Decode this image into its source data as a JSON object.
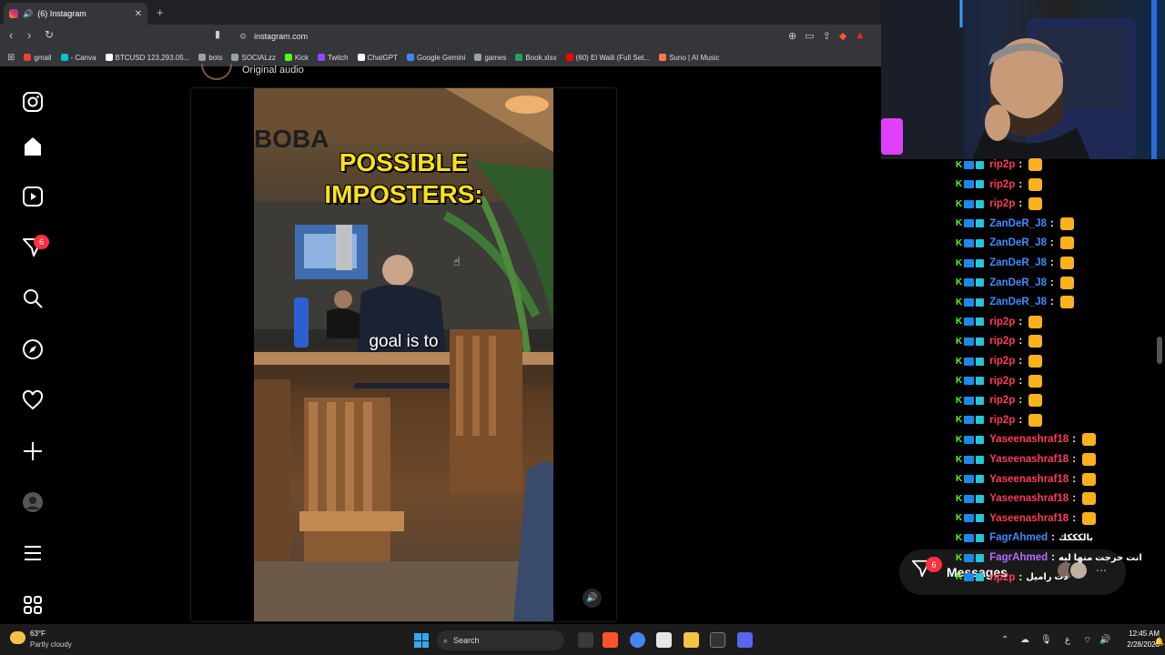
{
  "browser": {
    "tab_title": "(6) Instagram",
    "url": "instagram.com",
    "new_tab": "+",
    "bookmarks": [
      {
        "label": "gmail",
        "color": "#ea4335"
      },
      {
        "label": "- Canva",
        "color": "#00c4cc"
      },
      {
        "label": "BTCUSD 123,293.05...",
        "color": "#ffffff"
      },
      {
        "label": "bots",
        "color": "#9aa0a6"
      },
      {
        "label": "SOCIALzz",
        "color": "#9aa0a6"
      },
      {
        "label": "Kick",
        "color": "#53fc18"
      },
      {
        "label": "Twitch",
        "color": "#9146ff"
      },
      {
        "label": "ChatGPT",
        "color": "#ffffff"
      },
      {
        "label": "Google Gemini",
        "color": "#4285f4"
      },
      {
        "label": "games",
        "color": "#9aa0a6"
      },
      {
        "label": "Book.xlsx",
        "color": "#21a366"
      },
      {
        "label": "(60) El Waili (Full Set...",
        "color": "#ff0000"
      },
      {
        "label": "Suno | AI Music",
        "color": "#ff7a3d"
      }
    ]
  },
  "instagram": {
    "notification_count": "6",
    "nav_items": [
      "instagram-logo",
      "home",
      "reels",
      "messages",
      "search",
      "explore",
      "notifications",
      "create",
      "profile",
      "more",
      "also-from-meta"
    ],
    "post": {
      "audio_label": "Original audio",
      "sign_text": "BOBA",
      "headline": "POSSIBLE\nIMPOSTERS:",
      "caption": "goal is to"
    },
    "messages_pill": {
      "label": "Messages",
      "badge": "6"
    }
  },
  "chat": {
    "colors": {
      "rip2p": "#ff3b5c",
      "ZanDeR_J8": "#3f8cff",
      "Yaseenashraf18": "#ff3b5c",
      "FagrAhmed": "#b06cff"
    },
    "messages": [
      {
        "user": "rip2p",
        "text": "",
        "color": "#ff3b5c"
      },
      {
        "user": "rip2p",
        "text": "",
        "color": "#ff3b5c"
      },
      {
        "user": "rip2p",
        "text": "",
        "color": "#ff3b5c"
      },
      {
        "user": "ZanDeR_J8",
        "text": "",
        "color": "#3f8cff"
      },
      {
        "user": "ZanDeR_J8",
        "text": "",
        "color": "#3f8cff"
      },
      {
        "user": "ZanDeR_J8",
        "text": "",
        "color": "#3f8cff"
      },
      {
        "user": "ZanDeR_J8",
        "text": "",
        "color": "#3f8cff"
      },
      {
        "user": "ZanDeR_J8",
        "text": "",
        "color": "#3f8cff"
      },
      {
        "user": "rip2p",
        "text": "",
        "color": "#ff3b5c"
      },
      {
        "user": "rip2p",
        "text": "",
        "color": "#ff3b5c"
      },
      {
        "user": "rip2p",
        "text": "",
        "color": "#ff3b5c"
      },
      {
        "user": "rip2p",
        "text": "",
        "color": "#ff3b5c"
      },
      {
        "user": "rip2p",
        "text": "",
        "color": "#ff3b5c"
      },
      {
        "user": "rip2p",
        "text": "",
        "color": "#ff3b5c"
      },
      {
        "user": "Yaseenashraf18",
        "text": "",
        "color": "#ff3b5c"
      },
      {
        "user": "Yaseenashraf18",
        "text": "",
        "color": "#ff3b5c"
      },
      {
        "user": "Yaseenashraf18",
        "text": "",
        "color": "#ff3b5c"
      },
      {
        "user": "Yaseenashraf18",
        "text": "",
        "color": "#ff3b5c"
      },
      {
        "user": "Yaseenashraf18",
        "text": "",
        "color": "#ff3b5c"
      },
      {
        "user": "FagrAhmed",
        "text": "بالكككك",
        "color": "#3f8cff"
      },
      {
        "user": "FagrAhmed",
        "text": "انت خرجت منها ليه",
        "color": "#b06cff"
      },
      {
        "user": "rip2p",
        "text": "دت راميل",
        "color": "#ff3b5c"
      }
    ]
  },
  "taskbar": {
    "weather_temp": "63°F",
    "weather_desc": "Partly cloudy",
    "search_label": "Search",
    "time": "12:45 AM",
    "date": "2/28/2026",
    "lang": "ع"
  }
}
